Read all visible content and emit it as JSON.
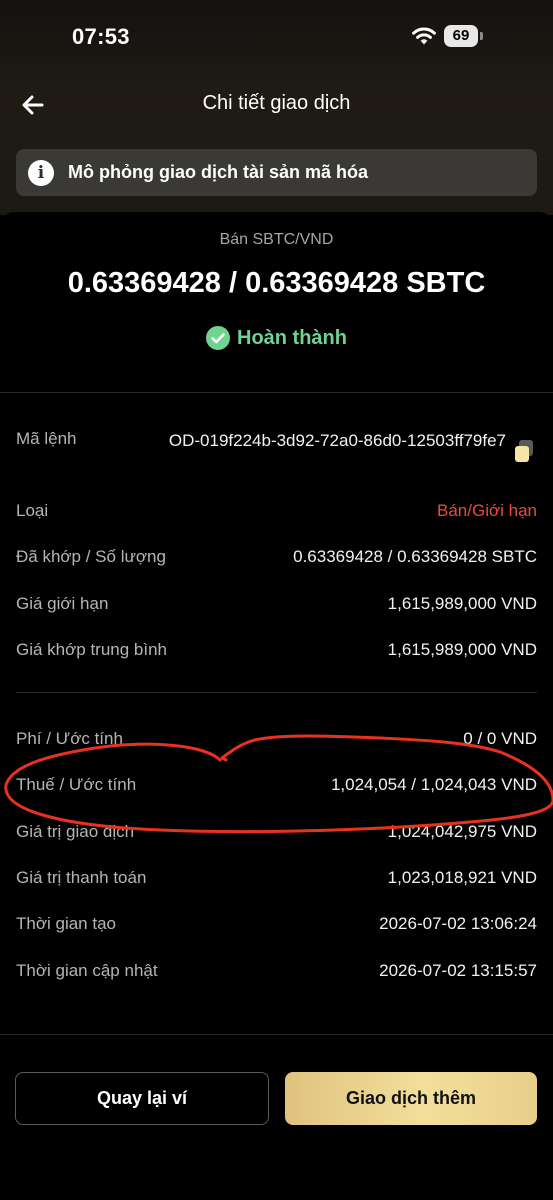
{
  "status_bar": {
    "time": "07:53",
    "battery": "69"
  },
  "header": {
    "title": "Chi tiết giao dịch"
  },
  "banner": {
    "icon_glyph": "i",
    "text": "Mô phỏng giao dịch tài sản mã hóa"
  },
  "summary": {
    "pair": "Bán SBTC/VND",
    "amount": "0.63369428 / 0.63369428 SBTC",
    "status": "Hoàn thành",
    "status_color": "#6fd391"
  },
  "details": {
    "order_id": {
      "label": "Mã lệnh",
      "value": "OD-019f224b-3d92-72a0-86d0-12503ff79fe7"
    },
    "type": {
      "label": "Loại",
      "value": "Bán/Giới hạn",
      "color": "#e74c3c"
    },
    "filled": {
      "label": "Đã khớp / Số lượng",
      "value": "0.63369428 / 0.63369428 SBTC"
    },
    "limit_price": {
      "label": "Giá giới hạn",
      "value": "1,615,989,000 VND"
    },
    "avg_price": {
      "label": "Giá khớp trung bình",
      "value": "1,615,989,000 VND"
    }
  },
  "fees": {
    "fee": {
      "label": "Phí / Ước tính",
      "value": "0 / 0 VND"
    },
    "tax": {
      "label": "Thuế / Ước tính",
      "value": "1,024,054 / 1,024,043 VND"
    },
    "trade_value": {
      "label": "Giá trị giao dịch",
      "value": "1,024,042,975 VND"
    },
    "settlement": {
      "label": "Giá trị thanh toán",
      "value": "1,023,018,921 VND"
    },
    "created": {
      "label": "Thời gian tạo",
      "value": "2026-07-02 13:06:24"
    },
    "updated": {
      "label": "Thời gian cập nhật",
      "value": "2026-07-02 13:15:57"
    }
  },
  "buttons": {
    "back_to_wallet": "Quay lại ví",
    "trade_more": "Giao dịch thêm"
  },
  "colors": {
    "accent_gold": "#e8cf88",
    "annotation_red": "#e8321e"
  }
}
